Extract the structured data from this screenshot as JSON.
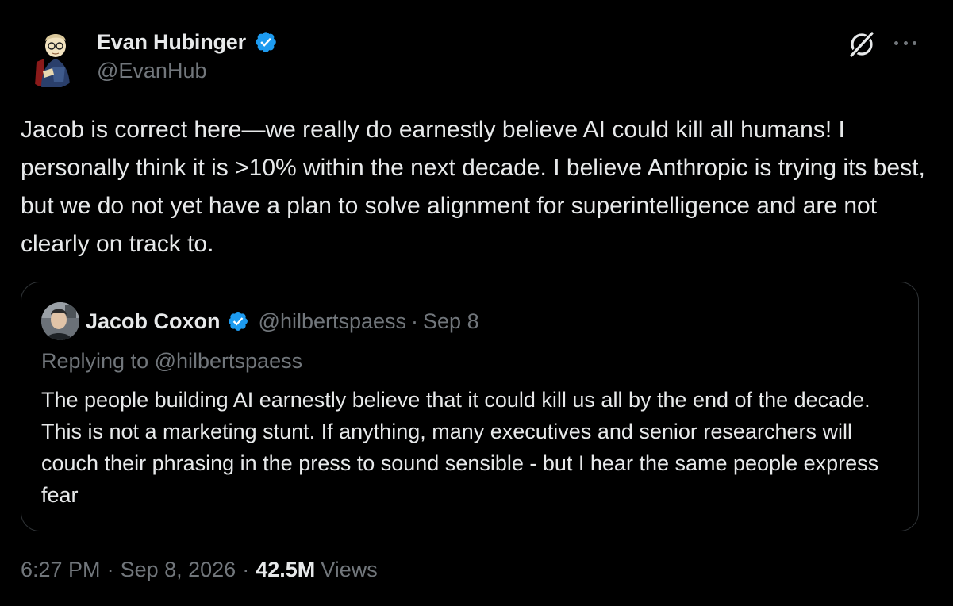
{
  "author": {
    "display_name": "Evan Hubinger",
    "handle": "@EvanHub",
    "verified": true
  },
  "tweet": {
    "text": "Jacob is correct here—we really do earnestly believe AI could kill all humans! I personally think it is >10% within the next decade. I believe Anthropic is trying its best, but we do not yet have a plan to solve alignment for superintelligence and are not clearly on track to."
  },
  "quoted_tweet": {
    "display_name": "Jacob Coxon",
    "handle": "@hilbertspaess",
    "separator": "·",
    "date": "Sep 8",
    "replying_prefix": "Replying to ",
    "replying_to": "@hilbertspaess",
    "text": "The people building AI earnestly believe that it could kill us all by the end of the decade. This is not a marketing stunt. If anything, many executives and senior researchers will couch their phrasing in the press to sound sensible - but I hear the same people express fear"
  },
  "meta": {
    "time": "6:27 PM",
    "date": "Sep 8, 2026",
    "separator": "·",
    "views_count": "42.5M",
    "views_label": "Views"
  },
  "icons": {
    "verified": "verified-badge-icon",
    "grok": "grok-icon",
    "more": "more-icon"
  },
  "colors": {
    "background": "#000000",
    "primary_text": "#e7e9ea",
    "secondary_text": "#71767b",
    "verified_blue": "#1d9bf0",
    "border": "#2f3336"
  }
}
